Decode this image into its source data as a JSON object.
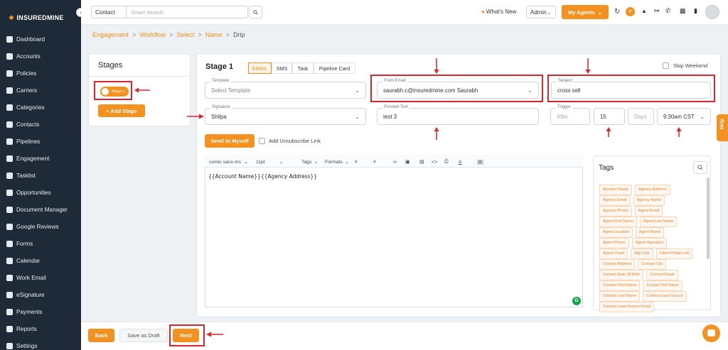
{
  "brand": {
    "name": "INSUREDMINE",
    "accent": "#f39220",
    "sidebar_bg": "#1e2a38"
  },
  "sidebar": {
    "items": [
      {
        "label": "Dashboard",
        "icon": "dashboard-icon"
      },
      {
        "label": "Accounts",
        "icon": "accounts-icon"
      },
      {
        "label": "Policies",
        "icon": "policies-icon"
      },
      {
        "label": "Carriers",
        "icon": "carriers-icon"
      },
      {
        "label": "Categories",
        "icon": "categories-icon"
      },
      {
        "label": "Contacts",
        "icon": "contacts-icon"
      },
      {
        "label": "Pipelines",
        "icon": "pipelines-icon"
      },
      {
        "label": "Engagement",
        "icon": "engagement-icon"
      },
      {
        "label": "Tasklist",
        "icon": "tasklist-icon"
      },
      {
        "label": "Opportunities",
        "icon": "opportunities-icon"
      },
      {
        "label": "Document Manager",
        "icon": "folder-icon"
      },
      {
        "label": "Google Reviews",
        "icon": "google-icon"
      },
      {
        "label": "Forms",
        "icon": "forms-icon"
      },
      {
        "label": "Calendar",
        "icon": "calendar-icon"
      },
      {
        "label": "Work Email",
        "icon": "mail-icon"
      },
      {
        "label": "eSignature",
        "icon": "signature-icon"
      },
      {
        "label": "Payments",
        "icon": "payments-icon"
      },
      {
        "label": "Reports",
        "icon": "reports-icon"
      },
      {
        "label": "Settings",
        "icon": "settings-icon"
      }
    ]
  },
  "topbar": {
    "search_scope": "Contact",
    "search_placeholder": "Smart Search",
    "whats_new": "What's New",
    "admin": "Admin",
    "my_agents": "My Agents"
  },
  "breadcrumb": [
    "Engagement",
    "Workflow",
    "Select",
    "Name",
    "Drip"
  ],
  "stages": {
    "title": "Stages",
    "current": "Stage 1",
    "add_label": "+ Add Stage"
  },
  "stage_form": {
    "title": "Stage 1",
    "tabs": [
      "EMAIL",
      "SMS",
      "Task",
      "Pipeline Card"
    ],
    "active_tab": "EMAIL",
    "skip_weekend": "Skip Weekend",
    "template": {
      "label": "Template",
      "value": "Select Template"
    },
    "from_email": {
      "label": "From Email",
      "value": "saurabh.c@insuredmine.com Saurabh"
    },
    "subject": {
      "label": "Subject",
      "value": "cross sell"
    },
    "signature": {
      "label": "Signature",
      "value": "Shilpa"
    },
    "preview_text": {
      "label": "Preview Text",
      "value": "test 3"
    },
    "trigger": {
      "label": "Trigger",
      "value": "After"
    },
    "number": "15",
    "unit": "Days",
    "time": "9:30am CST",
    "send_to_myself": "Send to Myself",
    "add_unsubscribe": "Add Unsubscribe Link"
  },
  "editor": {
    "font": "comic sans ms",
    "size": "11pt",
    "tags_menu": "Tags",
    "formats_menu": "Formats",
    "body": "{{Account Name}}{{Agency Address}}"
  },
  "tags": {
    "title": "Tags",
    "items": [
      [
        "Account Name",
        "Agency Address"
      ],
      [
        "Agency Email",
        "Agency Name"
      ],
      [
        "Agency Phone",
        "Agent Email"
      ],
      [
        "Agent First Name",
        "Agent Last Name"
      ],
      [
        "Agent Location",
        "Agent Name"
      ],
      [
        "Agent Phone",
        "Agent Signature"
      ],
      [
        "Agent Vcard",
        "App Link",
        "Client Portal Link"
      ],
      [
        "Contact Address",
        "Contact City"
      ],
      [
        "Contact Date Of Birth",
        "Contact Email"
      ],
      [
        "Contact First Name",
        "Contact Full Name"
      ],
      [
        "Contact Last Name",
        "Contact Lead Source"
      ],
      [
        "Contact Lead Source Email"
      ]
    ]
  },
  "footer": {
    "back": "Back",
    "save_draft": "Save as Draft",
    "next": "Next"
  },
  "help": "Help"
}
